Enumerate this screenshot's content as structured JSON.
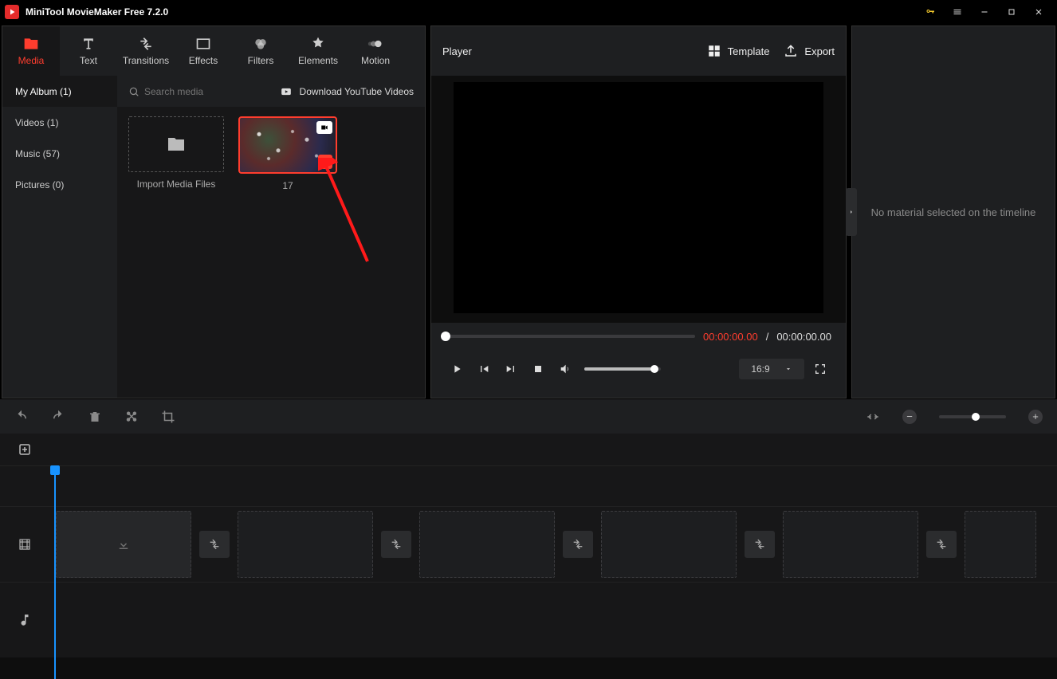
{
  "app": {
    "title": "MiniTool MovieMaker Free 7.2.0"
  },
  "tabs": {
    "media": "Media",
    "text": "Text",
    "transitions": "Transitions",
    "effects": "Effects",
    "filters": "Filters",
    "elements": "Elements",
    "motion": "Motion",
    "active": "media"
  },
  "sidebar": {
    "items": [
      {
        "label": "My Album (1)",
        "active": true
      },
      {
        "label": "Videos (1)",
        "active": false
      },
      {
        "label": "Music (57)",
        "active": false
      },
      {
        "label": "Pictures (0)",
        "active": false
      }
    ]
  },
  "mediabar": {
    "search_placeholder": "Search media",
    "download_yt": "Download YouTube Videos"
  },
  "media": {
    "import_label": "Import Media Files",
    "clip1_label": "17"
  },
  "player": {
    "title": "Player",
    "template": "Template",
    "export": "Export",
    "time_current": "00:00:00.00",
    "time_separator": "/",
    "time_total": "00:00:00.00",
    "ratio": "16:9"
  },
  "inspector": {
    "empty_text": "No material selected on the timeline"
  }
}
